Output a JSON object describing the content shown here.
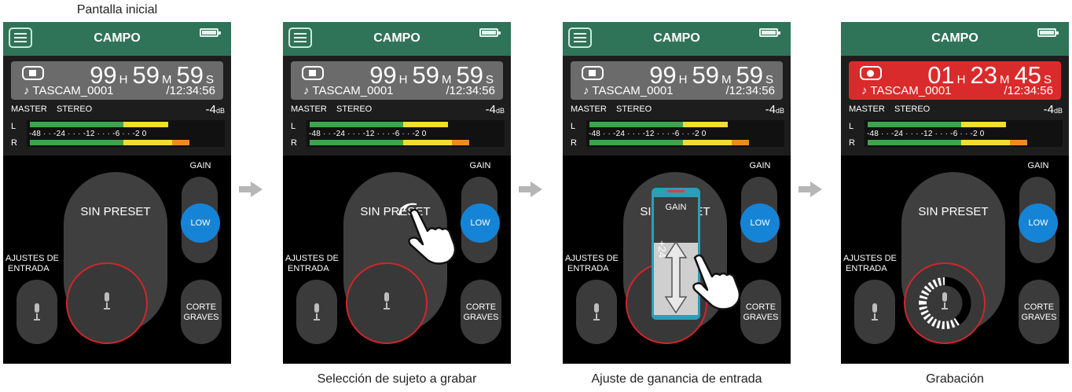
{
  "captions": {
    "top": "Pantalla inicial",
    "screen2": "Selección de sujeto a grabar",
    "screen3": "Ajuste de ganancia de entrada",
    "screen4": "Grabación"
  },
  "colors": {
    "header": "#2f7358",
    "counter_stopped": "#6b6b6b",
    "counter_recording": "#d92b2b",
    "low_button": "#1584d6",
    "meter_green": "#3fa34d",
    "meter_yellow": "#f2de2e",
    "meter_orange": "#ef8b1e",
    "rec_ring": "#d0262a"
  },
  "screens": [
    {
      "title": "CAMPO",
      "counter": {
        "state": "stop",
        "h": "99",
        "h_unit": "H",
        "m": "59",
        "m_unit": "M",
        "s": "59",
        "s_unit": "S",
        "file": "♪ TASCAM_0001",
        "remaining": "/12:34:56"
      },
      "meter": {
        "master": "MASTER",
        "mode": "STEREO",
        "db": "-4",
        "db_unit": "dB",
        "left": "L",
        "right": "R",
        "scale": "-48 · · -24 · · · -12 · · · -6 · · -2 0"
      },
      "preset": "SIN PRESET",
      "gain": "GAIN",
      "low": "LOW",
      "ajustes": [
        "AJUSTES DE",
        "ENTRADA"
      ],
      "corte": [
        "CORTE",
        "GRAVES"
      ]
    },
    {
      "title": "CAMPO",
      "counter": {
        "state": "stop",
        "h": "99",
        "h_unit": "H",
        "m": "59",
        "m_unit": "M",
        "s": "59",
        "s_unit": "S",
        "file": "♪ TASCAM_0001",
        "remaining": "/12:34:56"
      },
      "meter": {
        "master": "MASTER",
        "mode": "STEREO",
        "db": "-4",
        "db_unit": "dB",
        "left": "L",
        "right": "R",
        "scale": "-48 · · -24 · · · -12 · · · -6 · · -2 0"
      },
      "preset": "SIN PRESET",
      "gain": "GAIN",
      "low": "LOW",
      "ajustes": [
        "AJUSTES DE",
        "ENTRADA"
      ],
      "corte": [
        "CORTE",
        "GRAVES"
      ]
    },
    {
      "title": "CAMPO",
      "counter": {
        "state": "stop",
        "h": "99",
        "h_unit": "H",
        "m": "59",
        "m_unit": "M",
        "s": "59",
        "s_unit": "S",
        "file": "♪ TASCAM_0001",
        "remaining": "/12:34:56"
      },
      "meter": {
        "master": "MASTER",
        "mode": "STEREO",
        "db": "-4",
        "db_unit": "dB",
        "left": "L",
        "right": "R",
        "scale": "-48 · · -24 · · · -12 · · · -6 · · -2 0"
      },
      "preset": "SIN PRESET",
      "gain": "GAIN",
      "low": "LOW",
      "ajustes": [
        "AJUSTES DE",
        "ENTRADA"
      ],
      "corte": [
        "CORTE",
        "GRAVES"
      ],
      "popup": {
        "label": "GAIN",
        "value": "+24"
      }
    },
    {
      "title": "CAMPO",
      "counter": {
        "state": "record",
        "h": "01",
        "h_unit": "H",
        "m": "23",
        "m_unit": "M",
        "s": "45",
        "s_unit": "S",
        "file": "♪ TASCAM_0001",
        "remaining": "/12:34:56"
      },
      "meter": {
        "master": "MASTER",
        "mode": "STEREO",
        "db": "-4",
        "db_unit": "dB",
        "left": "L",
        "right": "R",
        "scale": "-48 · · -24 · · · -12 · · · -6 · · -2 0"
      },
      "preset": "SIN PRESET",
      "gain": "GAIN",
      "low": "LOW",
      "ajustes": [
        "AJUSTES DE",
        "ENTRADA"
      ],
      "corte": [
        "CORTE",
        "GRAVES"
      ]
    }
  ]
}
